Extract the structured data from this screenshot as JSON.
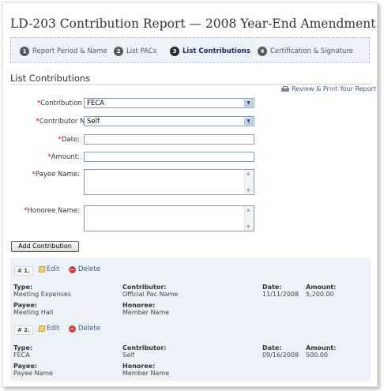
{
  "page_title": "LD-203 Contribution Report — 2008 Year-End Amendment",
  "steps": [
    {
      "num": "1",
      "label": "Report Period & Name"
    },
    {
      "num": "2",
      "label": "List PACs"
    },
    {
      "num": "3",
      "label": "List Contributions"
    },
    {
      "num": "4",
      "label": "Certification & Signature"
    }
  ],
  "section_title": "List Contributions",
  "print_link": "Review & Print Your Report",
  "form": {
    "required_mark": "*",
    "contribution_type": {
      "label": "Contribution Type:",
      "value": "FECA"
    },
    "contributor_name": {
      "label": "Contributor Name:",
      "value": "Self"
    },
    "date": {
      "label": "Date:",
      "value": ""
    },
    "amount": {
      "label": "Amount:",
      "value": ""
    },
    "payee_name": {
      "label": "Payee Name:",
      "value": ""
    },
    "honoree_name": {
      "label": "Honoree Name:",
      "value": ""
    },
    "add_button": "Add Contribution"
  },
  "field_headers": {
    "type": "Type:",
    "contributor": "Contributor:",
    "date": "Date:",
    "amount": "Amount:",
    "payee": "Payee:",
    "honoree": "Honoree:"
  },
  "actions": {
    "edit": "Edit",
    "delete": "Delete"
  },
  "contributions": [
    {
      "index": "# 1.",
      "type": "Meeting Expenses",
      "contributor": "Official Pac Name",
      "date": "11/11/2008",
      "amount": "5,200.00",
      "payee": "Meeting Hall",
      "honoree": "Member Name"
    },
    {
      "index": "# 2.",
      "type": "FECA",
      "contributor": "Self",
      "date": "09/16/2008",
      "amount": "500.00",
      "payee": "Payee Name",
      "honoree": "Member Name"
    }
  ],
  "colors": {
    "accent_link": "#3a5a8c",
    "required": "#cc0000",
    "panel_bg": "#edf2f8"
  }
}
